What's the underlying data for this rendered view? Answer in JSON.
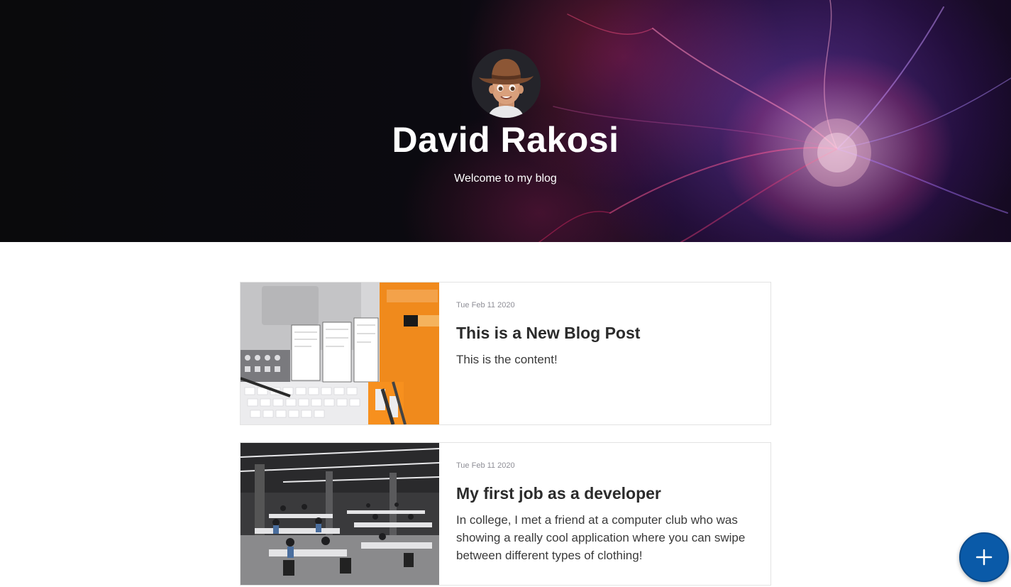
{
  "hero": {
    "title": "David Rakosi",
    "subtitle": "Welcome to my blog",
    "avatar_icon": "cowboy-memoji-avatar"
  },
  "posts": [
    {
      "date": "Tue Feb 11 2020",
      "title": "This is a New Blog Post",
      "excerpt": "This is the content!",
      "thumbnail": "ux-sketchbook-laptop-keyboard-photo"
    },
    {
      "date": "Tue Feb 11 2020",
      "title": "My first job as a developer",
      "excerpt": "In college, I met a friend at a computer club who was showing a really cool application where you can swipe between different types of clothing!",
      "thumbnail": "open-office-workspace-photo"
    }
  ],
  "fab": {
    "icon": "plus-icon",
    "color": "#0a5aa8"
  },
  "colors": {
    "hero_background": "#0b0a10",
    "hero_text": "#ffffff",
    "date_text": "#8e8e96",
    "card_border": "#e3e3e3"
  }
}
